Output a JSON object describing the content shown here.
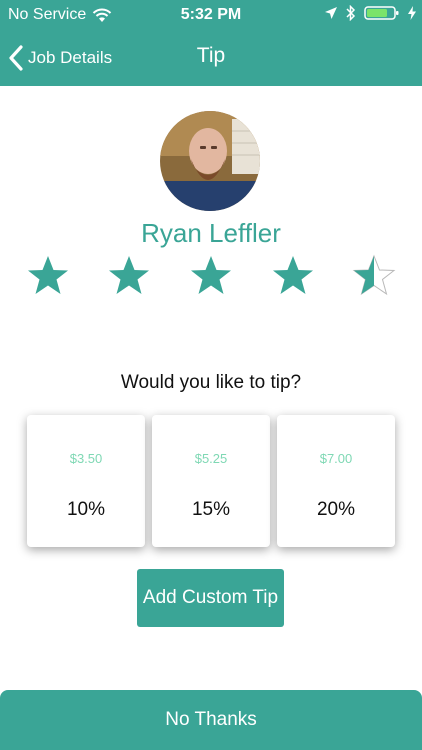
{
  "status_bar": {
    "carrier": "No Service",
    "time": "5:32 PM"
  },
  "nav": {
    "back_label": "Job Details",
    "title": "Tip"
  },
  "provider": {
    "name": "Ryan Leffler",
    "rating": 4.5,
    "max_rating": 5
  },
  "tip": {
    "prompt": "Would you like to tip?",
    "options": [
      {
        "amount": "$3.50",
        "percent": "10%"
      },
      {
        "amount": "$5.25",
        "percent": "15%"
      },
      {
        "amount": "$7.00",
        "percent": "20%"
      }
    ],
    "custom_label": "Add Custom Tip",
    "decline_label": "No Thanks"
  },
  "colors": {
    "accent": "#3aa596",
    "amount_text": "#7fd8b4"
  }
}
